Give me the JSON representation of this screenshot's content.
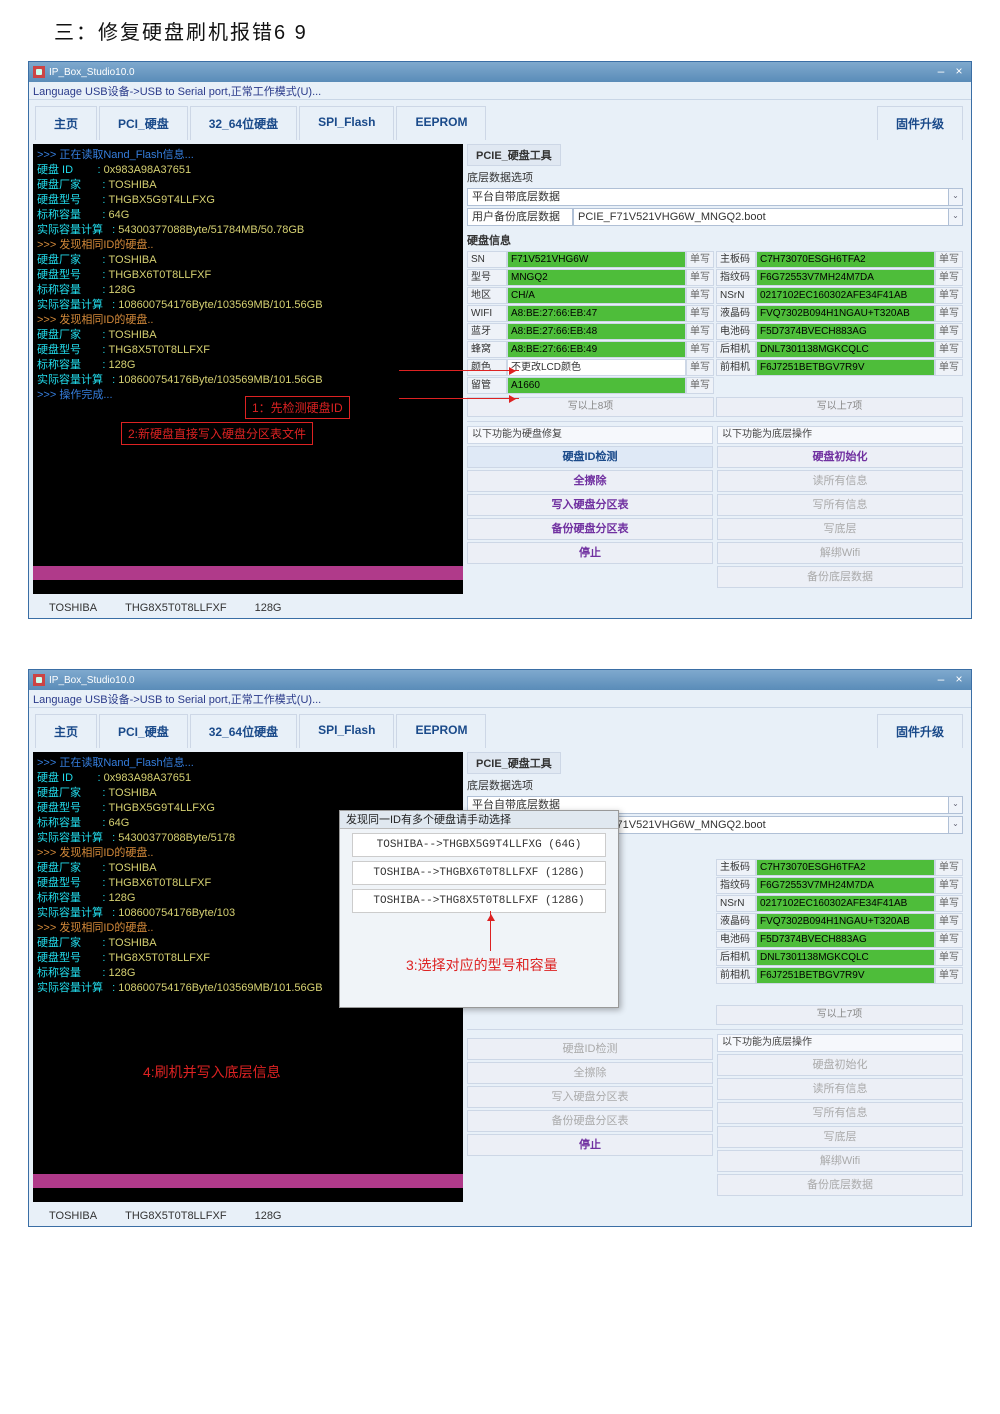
{
  "doc_title": "三：修复硬盘刷机报错6 9",
  "app": {
    "title": "IP_Box_Studio10.0",
    "menubar": "Language  USB设备->USB to Serial port,正常工作模式(U)...",
    "min": "–",
    "close": "×"
  },
  "tabs": [
    "主页",
    "PCI_硬盘",
    "32_64位硬盘",
    "SPI_Flash",
    "EEPROM",
    "固件升级"
  ],
  "console": {
    "read_head": ">>> 正在读取Nand_Flash信息...",
    "blocks": [
      {
        "id": "0x983A98A37651",
        "vendor": "TOSHIBA",
        "model": "THGBX5G9T4LLFXG",
        "nom": "64G",
        "real": "54300377088Byte/51784MB/50.78GB"
      },
      {
        "id": "",
        "vendor": "TOSHIBA",
        "model": "THGBX6T0T8LLFXF",
        "nom": "128G",
        "real": "108600754176Byte/103569MB/101.56GB"
      },
      {
        "id": "",
        "vendor": "TOSHIBA",
        "model": "THG8X5T0T8LLFXF",
        "nom": "128G",
        "real": "108600754176Byte/103569MB/101.56GB"
      }
    ],
    "found_same": ">>> 发现相同ID的硬盘..",
    "done": ">>> 操作完成...",
    "labels": {
      "id": "硬盘 ID",
      "vendor": "硬盘厂家",
      "model": "硬盘型号",
      "nom": "标称容量",
      "real": "实际容量计算"
    }
  },
  "status": {
    "vendor": "TOSHIBA",
    "model": "THG8X5T0T8LLFXF",
    "cap": "128G"
  },
  "right": {
    "section": "PCIE_硬盘工具",
    "low_opt": "底层数据选项",
    "builtin": "平台自带底层数据",
    "userbak_lbl": "用户备份底层数据",
    "userbak_val": "PCIE_F71V521VHG6W_MNGQ2.boot",
    "info_head": "硬盘信息",
    "left_rows": [
      {
        "l": "SN",
        "v": "F71V521VHG6W",
        "g": true
      },
      {
        "l": "型号",
        "v": "MNGQ2",
        "g": true
      },
      {
        "l": "地区",
        "v": "CH/A",
        "g": true
      },
      {
        "l": "WIFI",
        "v": "A8:BE:27:66:EB:47",
        "g": true
      },
      {
        "l": "蓝牙",
        "v": "A8:BE:27:66:EB:48",
        "g": true
      },
      {
        "l": "蜂窝",
        "v": "A8:BE:27:66:EB:49",
        "g": true
      },
      {
        "l": "颜色",
        "v": "不更改LCD颜色",
        "g": false
      },
      {
        "l": "留管",
        "v": "A1660",
        "g": true
      }
    ],
    "right_rows": [
      {
        "l": "主板码",
        "v": "C7H73070ESGH6TFA2",
        "g": true
      },
      {
        "l": "指纹码",
        "v": "F6G72553V7MH24M7DA",
        "g": true
      },
      {
        "l": "NSrN",
        "v": "0217102EC160302AFE34F41AB",
        "g": true
      },
      {
        "l": "液晶码",
        "v": "FVQ7302B094H1NGAU+T320AB",
        "g": true
      },
      {
        "l": "电池码",
        "v": "F5D7374BVECH883AG",
        "g": true
      },
      {
        "l": "后相机",
        "v": "DNL7301138MGKCQLC",
        "g": true
      },
      {
        "l": "前相机",
        "v": "F6J7251BETBGV7R9V",
        "g": true
      }
    ],
    "unit_btn": "单写",
    "write_up8": "写以上8项",
    "write_up7": "写以上7项",
    "leg_l": "以下功能为硬盘修复",
    "leg_r": "以下功能为底层操作",
    "left_btns": [
      "硬盘ID检测",
      "全擦除",
      "写入硬盘分区表",
      "备份硬盘分区表",
      "停止"
    ],
    "right_btns": [
      "硬盘初始化",
      "读所有信息",
      "写所有信息",
      "写底层",
      "解绑Wifi",
      "备份底层数据"
    ]
  },
  "annos": {
    "a1": "1：先检测硬盘ID",
    "a2": "2:新硬盘直接写入硬盘分区表文件",
    "a3": "3:选择对应的型号和容量",
    "a4": "4:刷机并写入底层信息"
  },
  "popup": {
    "title": "发现同一ID有多个硬盘请手动选择",
    "items": [
      "TOSHIBA-->THGBX5G9T4LLFXG (64G)",
      "TOSHIBA-->THGBX6T0T8LLFXF (128G)",
      "TOSHIBA-->THG8X5T0T8LLFXF (128G)"
    ]
  }
}
